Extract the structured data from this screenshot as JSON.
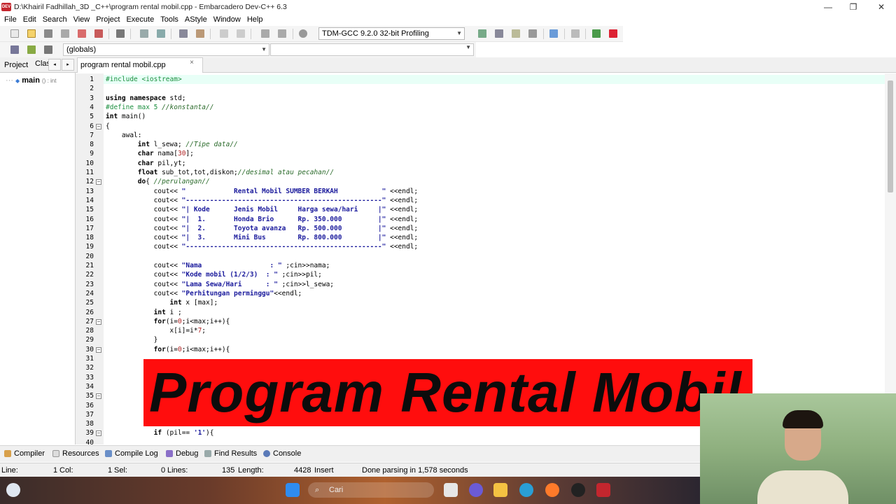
{
  "window": {
    "title": "D:\\Khairil Fadhillah_3D _C++\\program rental mobil.cpp - Embarcadero Dev-C++ 6.3",
    "app_icon_text": "DEV",
    "minimize": "—",
    "maximize": "❐",
    "close": "✕"
  },
  "menu": [
    "File",
    "Edit",
    "Search",
    "View",
    "Project",
    "Execute",
    "Tools",
    "AStyle",
    "Window",
    "Help"
  ],
  "toolbar": {
    "compiler": "TDM-GCC 9.2.0 32-bit Profiling",
    "globals": "(globals)"
  },
  "left_panel": {
    "tabs": [
      "Project",
      "Clas"
    ],
    "nav_left": "◂",
    "nav_right": "▸",
    "tree_item": "main",
    "tree_item_sig": "() : int"
  },
  "editor": {
    "tab_title": "program rental mobil.cpp",
    "tab_close": "×"
  },
  "code_lines": [
    {
      "n": "1",
      "text": "#include <iostream>"
    },
    {
      "n": "2",
      "text": ""
    },
    {
      "n": "3",
      "text": "using namespace std;"
    },
    {
      "n": "4",
      "text": "#define max 5 //konstanta//"
    },
    {
      "n": "5",
      "text": "int main()"
    },
    {
      "n": "6",
      "text": "{"
    },
    {
      "n": "7",
      "text": "    awal:"
    },
    {
      "n": "8",
      "text": "        int l_sewa; //Tipe data//"
    },
    {
      "n": "9",
      "text": "        char nama[30];"
    },
    {
      "n": "10",
      "text": "        char pil,yt;"
    },
    {
      "n": "11",
      "text": "        float sub_tot,tot,diskon;//desimal atau pecahan//"
    },
    {
      "n": "12",
      "text": "        do{ //perulangan//"
    },
    {
      "n": "13",
      "text": "            cout<< \"            Rental Mobil SUMBER BERKAH           \" <<endl;"
    },
    {
      "n": "14",
      "text": "            cout<< \"-------------------------------------------------\" <<endl;"
    },
    {
      "n": "15",
      "text": "            cout<< \"| Kode      Jenis Mobil     Harga sewa/hari     |\" <<endl;"
    },
    {
      "n": "16",
      "text": "            cout<< \"|  1.       Honda Brio      Rp. 350.000         |\" <<endl;"
    },
    {
      "n": "17",
      "text": "            cout<< \"|  2.       Toyota avanza   Rp. 500.000         |\" <<endl;"
    },
    {
      "n": "18",
      "text": "            cout<< \"|  3.       Mini Bus        Rp. 800.000         |\" <<endl;"
    },
    {
      "n": "19",
      "text": "            cout<< \"-------------------------------------------------\" <<endl;"
    },
    {
      "n": "20",
      "text": ""
    },
    {
      "n": "21",
      "text": "            cout<< \"Nama                 : \" ;cin>>nama;"
    },
    {
      "n": "22",
      "text": "            cout<< \"Kode mobil (1/2/3)  : \" ;cin>>pil;"
    },
    {
      "n": "23",
      "text": "            cout<< \"Lama Sewa/Hari      : \" ;cin>>l_sewa;"
    },
    {
      "n": "24",
      "text": "            cout<< \"Perhitungan perminggu\"<<endl;"
    },
    {
      "n": "25",
      "text": "                int x [max];"
    },
    {
      "n": "26",
      "text": "            int i ;"
    },
    {
      "n": "27",
      "text": "            for(i=0;i<max;i++){"
    },
    {
      "n": "28",
      "text": "                x[i]=i*7;"
    },
    {
      "n": "29",
      "text": "            }"
    },
    {
      "n": "30",
      "text": "            for(i=0;i<max;i++){"
    },
    {
      "n": "31",
      "text": ""
    },
    {
      "n": "32",
      "text": ""
    },
    {
      "n": "33",
      "text": ""
    },
    {
      "n": "34",
      "text": ""
    },
    {
      "n": "35",
      "text": ""
    },
    {
      "n": "36",
      "text": ""
    },
    {
      "n": "37",
      "text": ""
    },
    {
      "n": "38",
      "text": ""
    },
    {
      "n": "39",
      "text": "            if (pil== '1'){"
    },
    {
      "n": "40",
      "text": ""
    }
  ],
  "banner": {
    "text": "Program Rental Mobil"
  },
  "bottom_tabs": [
    "Compiler",
    "Resources",
    "Compile Log",
    "Debug",
    "Find Results",
    "Console"
  ],
  "status": {
    "line_label": "Line:",
    "line_val": "1",
    "col_label": "Col:",
    "col_val": "1",
    "sel_label": "Sel:",
    "sel_val": "0",
    "lines_label": "Lines:",
    "lines_val": "135",
    "length_label": "Length:",
    "length_val": "4428",
    "mode": "Insert",
    "message": "Done parsing in 1,578 seconds"
  },
  "taskbar": {
    "search_text": "Cari"
  },
  "colors": {
    "banner": "#ff0d0d",
    "preprocessor": "#1c8f3f",
    "comment": "#2a6a2a",
    "string": "#1a1a9c"
  }
}
